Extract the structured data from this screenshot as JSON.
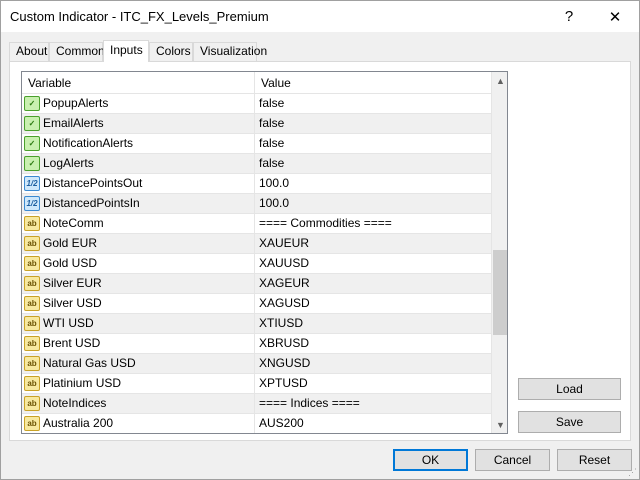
{
  "window": {
    "title": "Custom Indicator - ITC_FX_Levels_Premium",
    "help_label": "?",
    "close_label": "✕"
  },
  "tabs": [
    {
      "label": "About"
    },
    {
      "label": "Common"
    },
    {
      "label": "Inputs",
      "active": true
    },
    {
      "label": "Colors"
    },
    {
      "label": "Visualization"
    }
  ],
  "table": {
    "headers": {
      "variable": "Variable",
      "value": "Value"
    },
    "rows": [
      {
        "type": "bool",
        "icon": "bool-icon",
        "variable": "PopupAlerts",
        "value": "false"
      },
      {
        "type": "bool",
        "icon": "bool-icon",
        "variable": "EmailAlerts",
        "value": "false"
      },
      {
        "type": "bool",
        "icon": "bool-icon",
        "variable": "NotificationAlerts",
        "value": "false"
      },
      {
        "type": "bool",
        "icon": "bool-icon",
        "variable": "LogAlerts",
        "value": "false"
      },
      {
        "type": "num",
        "icon": "double-icon",
        "variable": "DistancePointsOut",
        "value": "100.0"
      },
      {
        "type": "num",
        "icon": "double-icon",
        "variable": "DistancedPointsIn",
        "value": "100.0"
      },
      {
        "type": "str",
        "icon": "string-icon",
        "variable": "NoteComm",
        "value": "==== Commodities ===="
      },
      {
        "type": "str",
        "icon": "string-icon",
        "variable": "Gold EUR",
        "value": "XAUEUR"
      },
      {
        "type": "str",
        "icon": "string-icon",
        "variable": "Gold USD",
        "value": "XAUUSD"
      },
      {
        "type": "str",
        "icon": "string-icon",
        "variable": "Silver EUR",
        "value": "XAGEUR"
      },
      {
        "type": "str",
        "icon": "string-icon",
        "variable": "Silver USD",
        "value": "XAGUSD"
      },
      {
        "type": "str",
        "icon": "string-icon",
        "variable": "WTI USD",
        "value": "XTIUSD"
      },
      {
        "type": "str",
        "icon": "string-icon",
        "variable": "Brent USD",
        "value": "XBRUSD"
      },
      {
        "type": "str",
        "icon": "string-icon",
        "variable": "Natural Gas USD",
        "value": "XNGUSD"
      },
      {
        "type": "str",
        "icon": "string-icon",
        "variable": "Platinium USD",
        "value": "XPTUSD"
      },
      {
        "type": "str",
        "icon": "string-icon",
        "variable": "NoteIndices",
        "value": "==== Indices ===="
      },
      {
        "type": "str",
        "icon": "string-icon",
        "variable": "Australia 200",
        "value": "AUS200"
      }
    ]
  },
  "icon_glyphs": {
    "bool": "✓",
    "num": "1/2",
    "str": "ab"
  },
  "buttons": {
    "load": "Load",
    "save": "Save",
    "ok": "OK",
    "cancel": "Cancel",
    "reset": "Reset"
  }
}
